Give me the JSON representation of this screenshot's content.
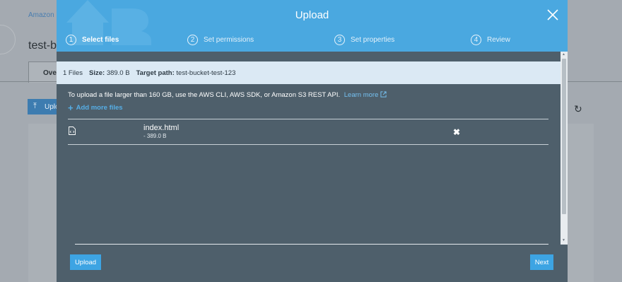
{
  "background": {
    "breadcrumb": "Amazon S",
    "title": "test-bu",
    "tab_label": "Ove",
    "upload_label": "Uplo",
    "upload_icon": "upload-icon",
    "refresh_icon": "refresh-icon"
  },
  "modal": {
    "title": "Upload",
    "close_icon": "close-icon",
    "steps": [
      {
        "num": "1",
        "label": "Select files"
      },
      {
        "num": "2",
        "label": "Set permissions"
      },
      {
        "num": "3",
        "label": "Set properties"
      },
      {
        "num": "4",
        "label": "Review"
      }
    ],
    "summary": {
      "files": "1 Files",
      "size_label": "Size:",
      "size_value": "389.0 B",
      "path_label": "Target path:",
      "path_value": "test-bucket-test-123"
    },
    "info_text": "To upload a file larger than 160 GB, use the AWS CLI, AWS SDK, or Amazon S3 REST API.",
    "learn_more": "Learn more",
    "external_icon": "external-link-icon",
    "add_more": "Add more files",
    "files": [
      {
        "name": "index.html",
        "size": "- 389.0 B",
        "icon": "file-code-icon"
      }
    ],
    "upload_button": "Upload",
    "next_button": "Next",
    "colors": {
      "header": "#4aa8e0",
      "body": "#4e5f6b",
      "summary": "#dbe9f4",
      "button": "#3da4e3",
      "link": "#75c0f0"
    }
  }
}
